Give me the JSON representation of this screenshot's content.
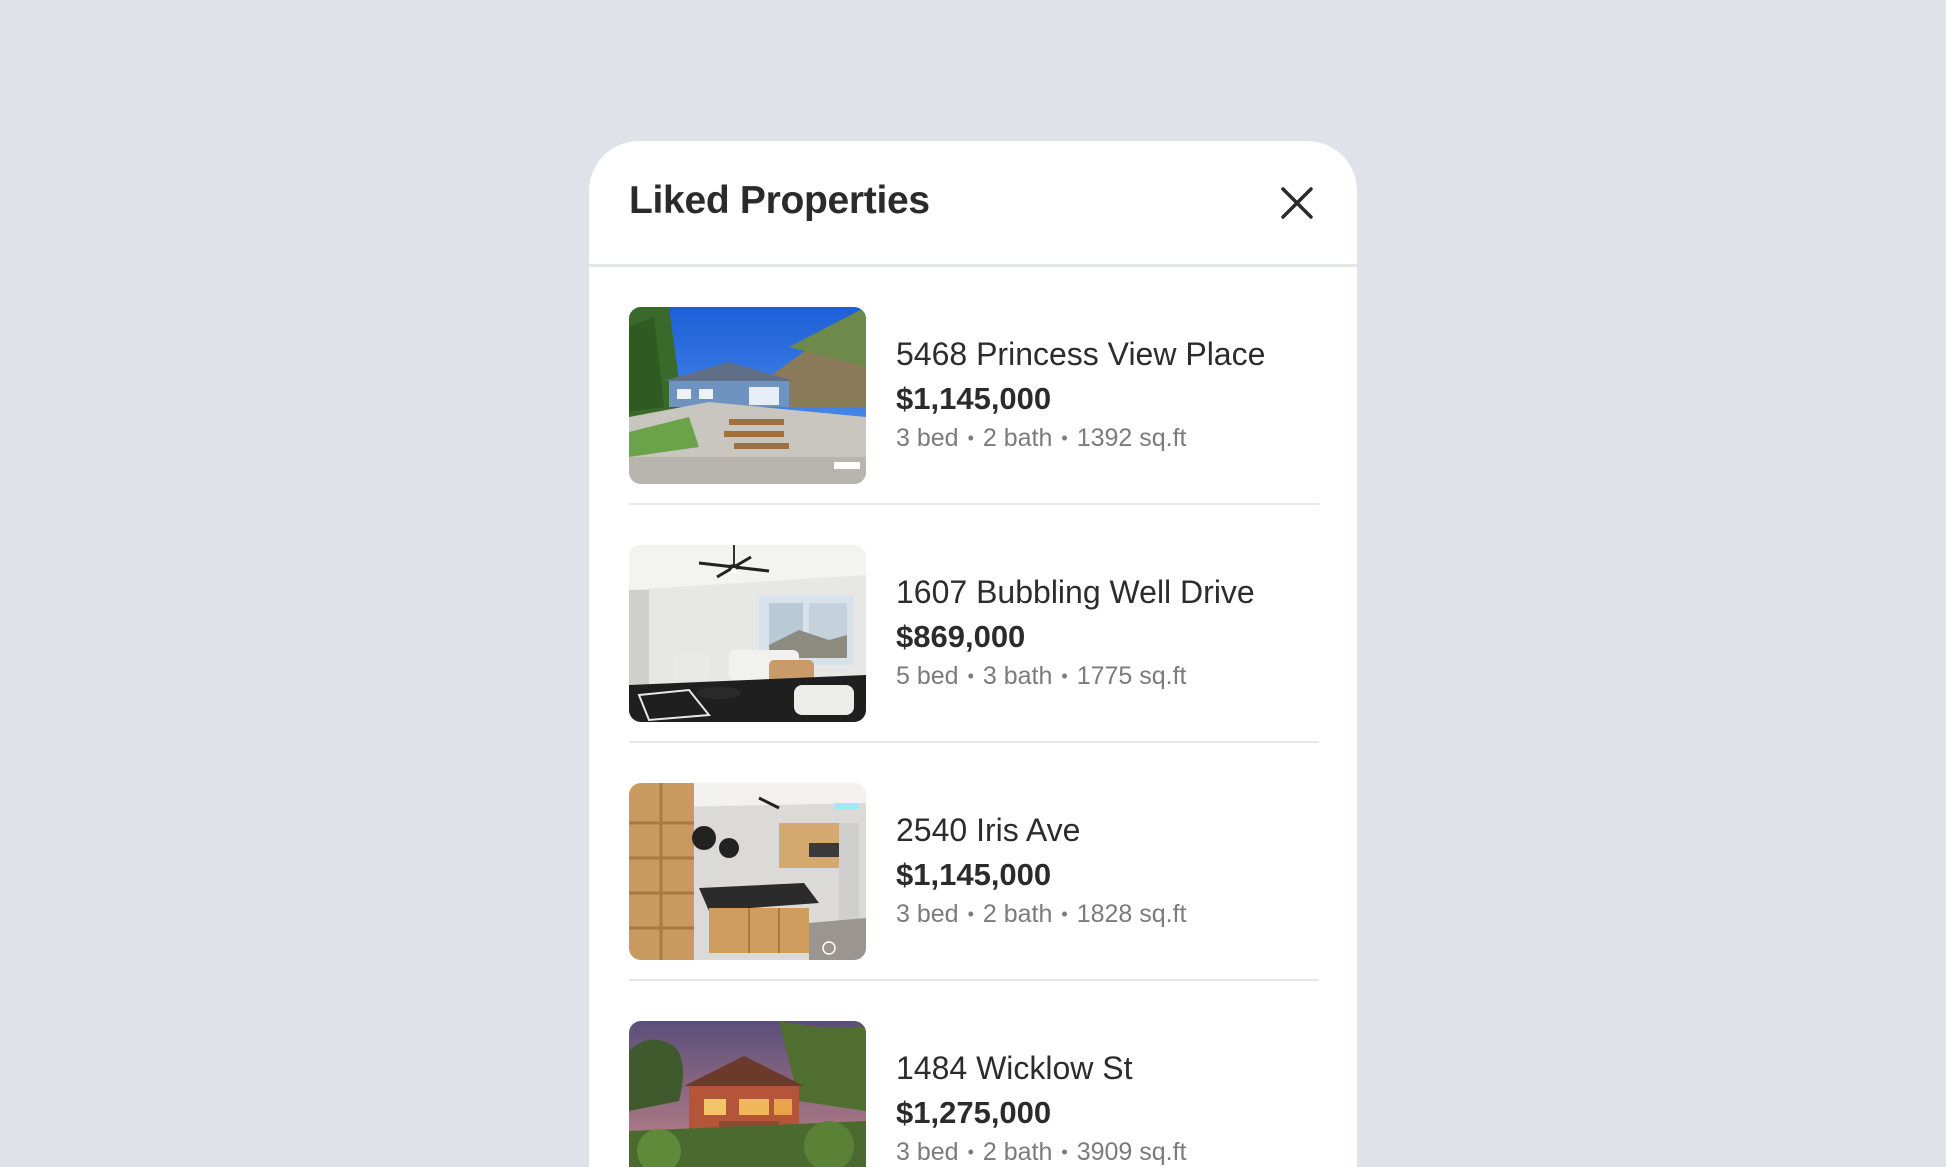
{
  "panel": {
    "title": "Liked Properties",
    "close_icon": "close-icon"
  },
  "properties": [
    {
      "address": "5468 Princess View Place",
      "price": "$1,145,000",
      "beds": "3 bed",
      "baths": "2 bath",
      "area": "1392 sq.ft",
      "photo_icon": "house-exterior-photo"
    },
    {
      "address": "1607 Bubbling Well Drive",
      "price": "$869,000",
      "beds": "5 bed",
      "baths": "3 bath",
      "area": "1775 sq.ft",
      "photo_icon": "living-room-photo"
    },
    {
      "address": "2540 Iris Ave",
      "price": "$1,145,000",
      "beds": "3 bed",
      "baths": "2 bath",
      "area": "1828 sq.ft",
      "photo_icon": "kitchen-photo"
    },
    {
      "address": "1484 Wicklow St",
      "price": "$1,275,000",
      "beds": "3 bed",
      "baths": "2 bath",
      "area": "3909 sq.ft",
      "photo_icon": "house-dusk-photo"
    }
  ],
  "specs_separator": "•"
}
